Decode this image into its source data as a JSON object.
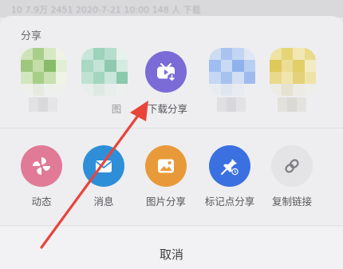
{
  "status_bar": {
    "text": "10 7.9万  2451  2020-7-21 10:00  148 人 下载"
  },
  "share_section": {
    "title": "分享"
  },
  "apps": [
    {
      "label": "",
      "icon": "blurred-app-icon"
    },
    {
      "label": "图",
      "icon": "blurred-app-icon"
    },
    {
      "label": "下载分享",
      "icon": "tv-download-icon",
      "color": "#7b6bd6"
    },
    {
      "label": "",
      "icon": "blurred-app-icon"
    },
    {
      "label": "",
      "icon": "blurred-app-icon"
    }
  ],
  "actions": [
    {
      "label": "动态",
      "icon": "pinwheel-icon",
      "color": "#e07a96"
    },
    {
      "label": "消息",
      "icon": "envelope-icon",
      "color": "#2e8fd8"
    },
    {
      "label": "图片分享",
      "icon": "image-icon",
      "color": "#e89a3a"
    },
    {
      "label": "标记点分享",
      "icon": "pin-icon",
      "color": "#3a70e0"
    },
    {
      "label": "复制链接",
      "icon": "link-icon",
      "color": "#e4e4e6"
    }
  ],
  "cancel_label": "取消",
  "annotation": {
    "color": "#e8443a"
  }
}
